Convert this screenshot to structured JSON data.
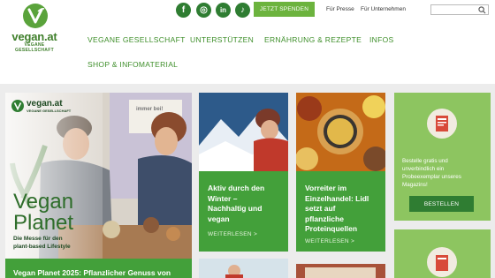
{
  "logo": {
    "name": "vegan.at",
    "subtitle": "VEGANE GESELLSCHAFT"
  },
  "social": [
    {
      "icon": "facebook-icon",
      "glyph": "f"
    },
    {
      "icon": "instagram-icon",
      "glyph": "◎"
    },
    {
      "icon": "linkedin-icon",
      "glyph": "in"
    },
    {
      "icon": "tiktok-icon",
      "glyph": "♪"
    }
  ],
  "topbar": {
    "donate_label": "JETZT SPENDEN",
    "press_label": "Für Presse",
    "business_label": "Für Unternehmen",
    "search_placeholder": ""
  },
  "nav": [
    {
      "label": "VEGANE GESELLSCHAFT"
    },
    {
      "label": "UNTERSTÜTZEN"
    },
    {
      "label": "ERNÄHRUNG & REZEPTE"
    },
    {
      "label": "INFOS"
    },
    {
      "label": "SHOP & INFOMATERIAL"
    }
  ],
  "featured": {
    "logo_text": "vegan.at",
    "logo_sub": "VEGANE GESELLSCHAFT",
    "headline_line1": "Vegan",
    "headline_line2": "Planet",
    "tagline_line1": "Die Messe für den",
    "tagline_line2": "plant-based Lifestyle",
    "banner_text": "immer bei!",
    "title": "Vegan Planet 2025: Pflanzlicher Genuss von"
  },
  "articles": [
    {
      "title_lines": [
        "Aktiv durch den",
        "Winter –",
        "Nachhaltig und",
        "vegan"
      ],
      "read_more": "WEITERLESEN  >"
    },
    {
      "title_lines": [
        "Vorreiter im",
        "Einzelhandel: Lidl",
        "setzt auf",
        "pflanzliche",
        "Proteinquellen"
      ],
      "read_more": "WEITERLESEN  >"
    }
  ],
  "magazine": {
    "text_lines": [
      "Bestelle gratis und",
      "unverbindlich ein",
      "Probeexemplar unseres",
      "Magazins!"
    ],
    "button_label": "BESTELLEN"
  },
  "colors": {
    "brand_green": "#43a03a",
    "dark_green": "#2f7d32",
    "light_green": "#8dc560",
    "nav_green": "#3f8f2b",
    "donate_green": "#6cb33e"
  }
}
